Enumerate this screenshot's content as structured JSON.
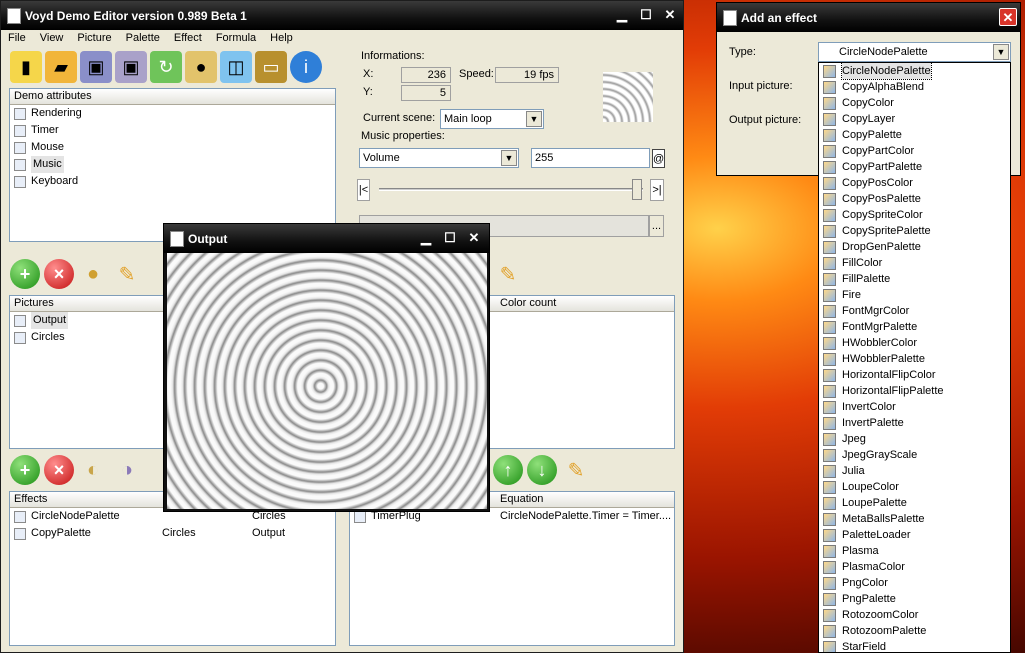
{
  "main_window": {
    "title": "Voyd Demo Editor version 0.989 Beta 1",
    "menu": [
      "File",
      "View",
      "Picture",
      "Palette",
      "Effect",
      "Formula",
      "Help"
    ],
    "toolbar_icons": [
      "new-icon",
      "open-icon",
      "save-icon",
      "save-as-icon",
      "refresh-icon",
      "palette-icon",
      "window-icon",
      "picture-icon",
      "info-icon"
    ]
  },
  "demo_attributes": {
    "header": "Demo attributes",
    "items": [
      "Rendering",
      "Timer",
      "Mouse",
      "Music",
      "Keyboard"
    ],
    "selected": "Music"
  },
  "informations": {
    "label": "Informations:",
    "x_label": "X:",
    "x": "236",
    "y_label": "Y:",
    "y": "5",
    "speed_label": "Speed:",
    "speed": "19 fps",
    "scene_label": "Current scene:",
    "scene": "Main loop"
  },
  "music": {
    "label": "Music properties:",
    "property": "Volume",
    "value": "255",
    "at": "@",
    "start": "|<",
    "end": ">|",
    "browse": "..."
  },
  "pictures": {
    "header": "Pictures",
    "color_count": "Color count",
    "items": [
      "Output",
      "Circles"
    ]
  },
  "effects": {
    "header": "Effects",
    "rows": [
      {
        "name": "CircleNodePalette",
        "src": "",
        "dst": "Circles"
      },
      {
        "name": "CopyPalette",
        "src": "Circles",
        "dst": "Output"
      }
    ]
  },
  "formulas": {
    "equation_header": "Equation",
    "rows": [
      {
        "name": "TimerPlug",
        "equation": "CircleNodePalette.Timer = Timer...."
      }
    ]
  },
  "output_window": {
    "title": "Output"
  },
  "add_effect": {
    "title": "Add an effect",
    "type_label": "Type:",
    "type_value": "CircleNodePalette",
    "input_label": "Input picture:",
    "output_label": "Output picture:",
    "options": [
      "CircleNodePalette",
      "CopyAlphaBlend",
      "CopyColor",
      "CopyLayer",
      "CopyPalette",
      "CopyPartColor",
      "CopyPartPalette",
      "CopyPosColor",
      "CopyPosPalette",
      "CopySpriteColor",
      "CopySpritePalette",
      "DropGenPalette",
      "FillColor",
      "FillPalette",
      "Fire",
      "FontMgrColor",
      "FontMgrPalette",
      "HWobblerColor",
      "HWobblerPalette",
      "HorizontalFlipColor",
      "HorizontalFlipPalette",
      "InvertColor",
      "InvertPalette",
      "Jpeg",
      "JpegGrayScale",
      "Julia",
      "LoupeColor",
      "LoupePalette",
      "MetaBallsPalette",
      "PaletteLoader",
      "Plasma",
      "PlasmaColor",
      "PngColor",
      "PngPalette",
      "RotozoomColor",
      "RotozoomPalette",
      "StarField"
    ]
  }
}
